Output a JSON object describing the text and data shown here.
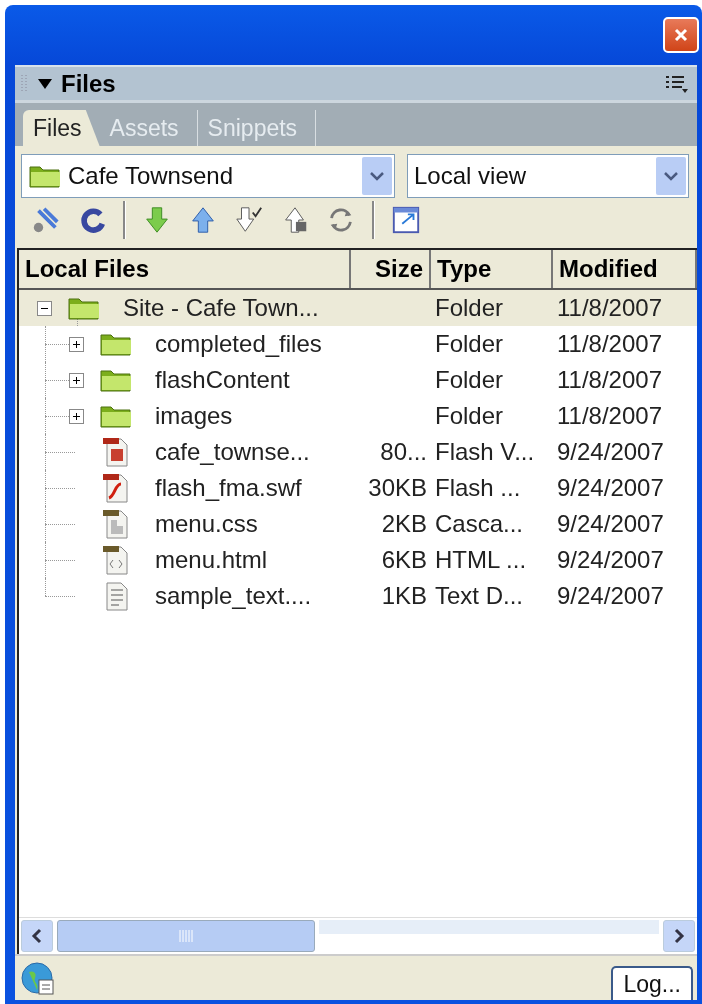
{
  "panel": {
    "title": "Files",
    "expanded": true
  },
  "tabs": [
    {
      "label": "Files",
      "selected": true
    },
    {
      "label": "Assets",
      "selected": false
    },
    {
      "label": "Snippets",
      "selected": false
    }
  ],
  "site_select": {
    "value": "Cafe Townsend"
  },
  "view_select": {
    "value": "Local view"
  },
  "table": {
    "columns": [
      "Local Files",
      "Size",
      "Type",
      "Modified"
    ],
    "tree": [
      {
        "name": "Site - Cafe Town...",
        "kind": "folder",
        "expanded": true,
        "selected": true,
        "type": "Folder",
        "modified": "11/8/2007",
        "children": [
          {
            "name": "completed_files",
            "kind": "folder",
            "expanded": false,
            "selected": false,
            "type": "Folder",
            "modified": "11/8/2007"
          },
          {
            "name": "flashContent",
            "kind": "folder",
            "expanded": false,
            "selected": false,
            "type": "Folder",
            "modified": "11/8/2007"
          },
          {
            "name": "images",
            "kind": "folder",
            "expanded": false,
            "selected": false,
            "type": "Folder",
            "modified": "11/8/2007"
          },
          {
            "name": "cafe_townse...",
            "kind": "video",
            "selected": false,
            "size": "80...",
            "type": "Flash V...",
            "modified": "9/24/2007"
          },
          {
            "name": "flash_fma.swf",
            "kind": "flash",
            "selected": false,
            "size": "30KB",
            "type": "Flash ...",
            "modified": "9/24/2007"
          },
          {
            "name": "menu.css",
            "kind": "css",
            "selected": false,
            "size": "2KB",
            "type": "Casca...",
            "modified": "9/24/2007"
          },
          {
            "name": "menu.html",
            "kind": "html",
            "selected": false,
            "size": "6KB",
            "type": "HTML ...",
            "modified": "9/24/2007"
          },
          {
            "name": "sample_text....",
            "kind": "text",
            "selected": false,
            "size": "1KB",
            "type": "Text D...",
            "modified": "9/24/2007"
          }
        ]
      }
    ]
  },
  "status_bar": {
    "log_button": "Log..."
  }
}
